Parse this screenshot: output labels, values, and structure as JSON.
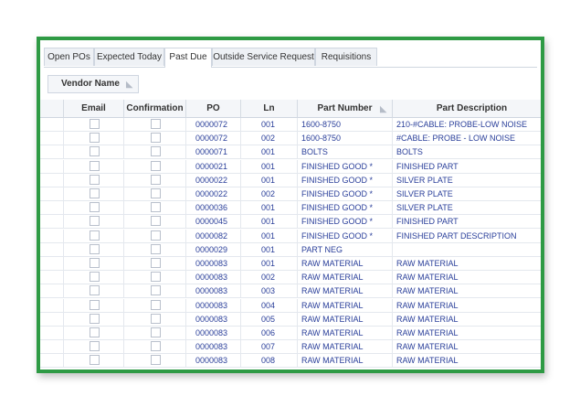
{
  "tabs": [
    "Open POs",
    "Expected Today",
    "Past Due",
    "Outside Service Request",
    "Requisitions"
  ],
  "active_tab": "Past Due",
  "group_by": {
    "label": "Vendor Name"
  },
  "columns": [
    "Email",
    "Confirmation",
    "PO",
    "Ln",
    "Part Number",
    "Part Description"
  ],
  "rows": [
    {
      "po": "0000072",
      "ln": "001",
      "part_number": "1600-8750",
      "description": "210-#CABLE: PROBE-LOW NOISE"
    },
    {
      "po": "0000072",
      "ln": "002",
      "part_number": "1600-8750",
      "description": "#CABLE: PROBE -  LOW NOISE"
    },
    {
      "po": "0000071",
      "ln": "001",
      "part_number": "BOLTS",
      "description": "BOLTS"
    },
    {
      "po": "0000021",
      "ln": "001",
      "part_number": "FINISHED GOOD   *",
      "description": "FINISHED PART"
    },
    {
      "po": "0000022",
      "ln": "001",
      "part_number": "FINISHED GOOD   *",
      "description": "SILVER PLATE"
    },
    {
      "po": "0000022",
      "ln": "002",
      "part_number": "FINISHED GOOD   *",
      "description": "SILVER PLATE"
    },
    {
      "po": "0000036",
      "ln": "001",
      "part_number": "FINISHED GOOD   *",
      "description": "SILVER PLATE"
    },
    {
      "po": "0000045",
      "ln": "001",
      "part_number": "FINISHED GOOD   *",
      "description": "FINISHED PART"
    },
    {
      "po": "0000082",
      "ln": "001",
      "part_number": "FINISHED GOOD   *",
      "description": "FINISHED PART DESCRIPTION"
    },
    {
      "po": "0000029",
      "ln": "001",
      "part_number": "PART NEG",
      "description": ""
    },
    {
      "po": "0000083",
      "ln": "001",
      "part_number": "RAW MATERIAL",
      "description": "RAW MATERIAL"
    },
    {
      "po": "0000083",
      "ln": "002",
      "part_number": "RAW MATERIAL",
      "description": "RAW MATERIAL"
    },
    {
      "po": "0000083",
      "ln": "003",
      "part_number": "RAW MATERIAL",
      "description": "RAW MATERIAL"
    },
    {
      "po": "0000083",
      "ln": "004",
      "part_number": "RAW MATERIAL",
      "description": "RAW MATERIAL"
    },
    {
      "po": "0000083",
      "ln": "005",
      "part_number": "RAW MATERIAL",
      "description": "RAW MATERIAL"
    },
    {
      "po": "0000083",
      "ln": "006",
      "part_number": "RAW MATERIAL",
      "description": "RAW MATERIAL"
    },
    {
      "po": "0000083",
      "ln": "007",
      "part_number": "RAW MATERIAL",
      "description": "RAW MATERIAL"
    },
    {
      "po": "0000083",
      "ln": "008",
      "part_number": "RAW MATERIAL",
      "description": "RAW MATERIAL"
    }
  ],
  "colors": {
    "frame_border": "#2e9a44",
    "cell_text": "#2a3f9a",
    "header_bg": "#f4f6f9"
  },
  "icons": {
    "sort": "sort-icon"
  }
}
